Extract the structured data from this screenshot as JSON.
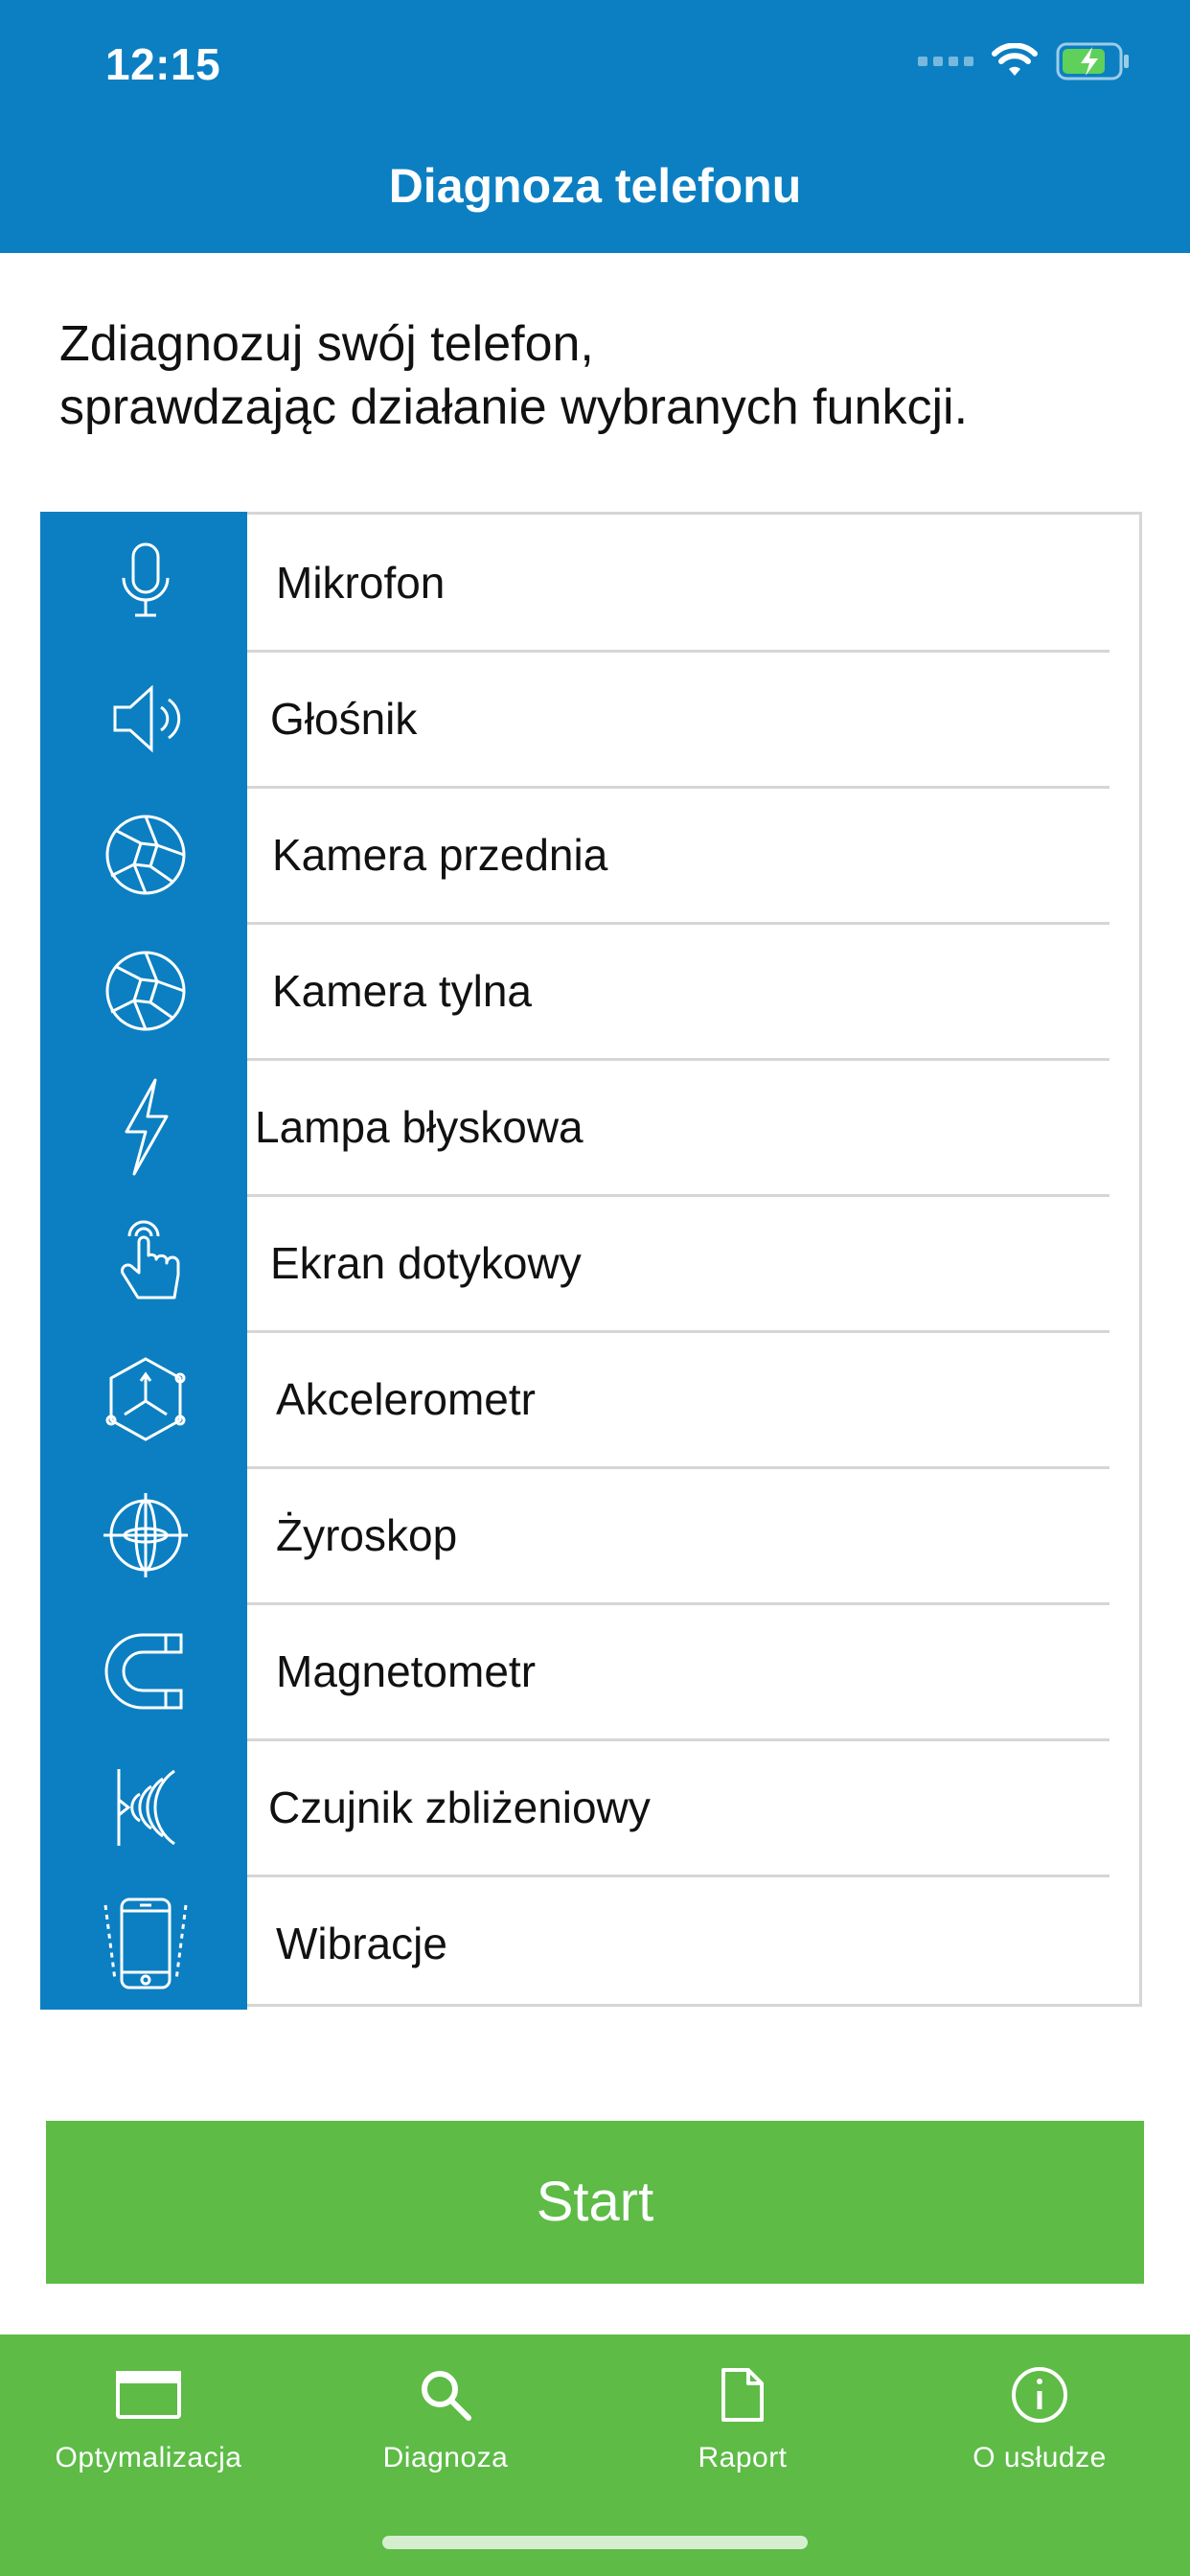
{
  "status_bar": {
    "time": "12:15"
  },
  "header": {
    "title": "Diagnoza telefonu"
  },
  "intro": {
    "line1": "Zdiagnozuj swój telefon,",
    "line2": "sprawdzając działanie wybranych funkcji."
  },
  "diagnostics": {
    "items": [
      {
        "label": "Mikrofon",
        "icon": "microphone-icon"
      },
      {
        "label": "Głośnik",
        "icon": "speaker-icon"
      },
      {
        "label": "Kamera przednia",
        "icon": "camera-aperture-icon"
      },
      {
        "label": "Kamera tylna",
        "icon": "camera-aperture-icon"
      },
      {
        "label": "Lampa błyskowa",
        "icon": "lightning-icon"
      },
      {
        "label": "Ekran dotykowy",
        "icon": "touch-hand-icon"
      },
      {
        "label": "Akcelerometr",
        "icon": "accelerometer-cube-icon"
      },
      {
        "label": "Żyroskop",
        "icon": "gyroscope-icon"
      },
      {
        "label": "Magnetometr",
        "icon": "magnet-icon"
      },
      {
        "label": "Czujnik zbliżeniowy",
        "icon": "proximity-waves-icon"
      },
      {
        "label": "Wibracje",
        "icon": "vibrating-phone-icon"
      }
    ]
  },
  "start_button": {
    "label": "Start"
  },
  "tabbar": {
    "tabs": [
      {
        "label": "Optymalizacja",
        "icon": "window-icon"
      },
      {
        "label": "Diagnoza",
        "icon": "search-icon"
      },
      {
        "label": "Raport",
        "icon": "document-icon"
      },
      {
        "label": "O usłudze",
        "icon": "info-icon"
      }
    ]
  },
  "colors": {
    "header_blue": "#0b7fc2",
    "accent_green": "#5dbb46",
    "divider": "#d6d6d6"
  }
}
